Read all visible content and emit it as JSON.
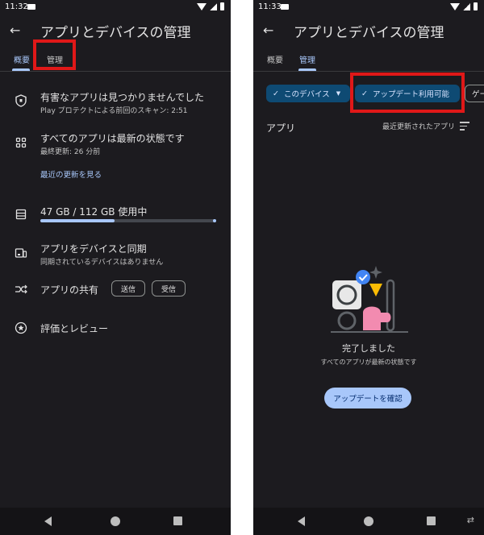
{
  "left": {
    "status_time": "11:32",
    "title": "アプリとデバイスの管理",
    "tabs": [
      "概要",
      "管理"
    ],
    "rows": {
      "protect_title": "有害なアプリは見つかりませんでした",
      "protect_sub": "Play プロテクトによる前回のスキャン: 2:51",
      "update_title": "すべてのアプリは最新の状態です",
      "update_sub": "最終更新: 26 分前",
      "update_link": "最近の更新を見る",
      "storage_title": "47 GB / 112 GB 使用中",
      "storage_used_fraction": 0.42,
      "sync_title": "アプリをデバイスと同期",
      "sync_sub": "同期されているデバイスはありません",
      "share_title": "アプリの共有",
      "share_send": "送信",
      "share_receive": "受信",
      "review_title": "評価とレビュー"
    }
  },
  "right": {
    "status_time": "11:33",
    "title": "アプリとデバイスの管理",
    "tabs": [
      "概要",
      "管理"
    ],
    "chips": {
      "device": "このデバイス",
      "updates": "アップデート利用可能",
      "game": "ゲー"
    },
    "section_title": "アプリ",
    "sort_label": "最近更新されたアプリ",
    "done_title": "完了しました",
    "done_sub": "すべてのアプリが最新の状態です",
    "check_button": "アップデートを確認"
  },
  "colors": {
    "accent": "#a8c7fa",
    "highlight": "#e01818",
    "background": "#1c1b1f"
  }
}
